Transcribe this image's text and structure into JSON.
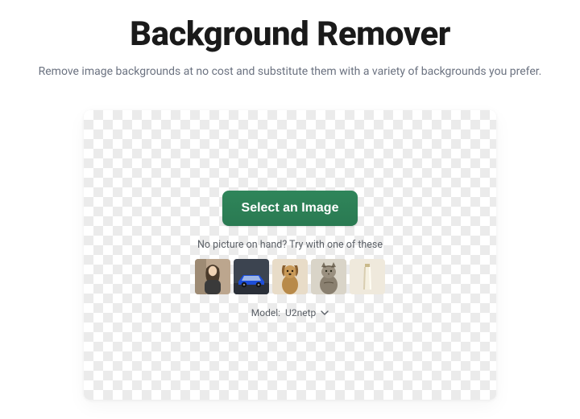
{
  "header": {
    "title": "Background Remover",
    "subtitle": "Remove image backgrounds at no cost and substitute them with a variety of backgrounds you prefer."
  },
  "uploader": {
    "button_label": "Select an Image",
    "hint": "No picture on hand? Try with one of these",
    "samples": [
      {
        "name": "person"
      },
      {
        "name": "car"
      },
      {
        "name": "dog"
      },
      {
        "name": "cat"
      },
      {
        "name": "cosmetic-tube"
      }
    ],
    "model_label": "Model:",
    "model_value": "U2netp"
  },
  "colors": {
    "primary": "#2f855a"
  }
}
